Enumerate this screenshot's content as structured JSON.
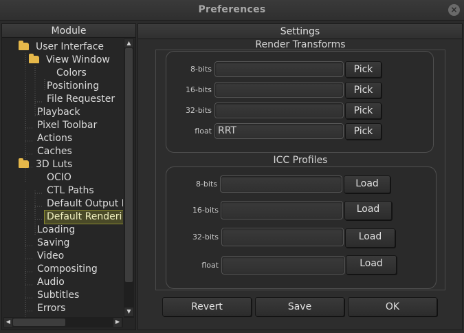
{
  "window": {
    "title": "Preferences",
    "close_glyph": "×"
  },
  "module_pane": {
    "header": "Module",
    "items": [
      {
        "label": "User Interface",
        "folder": true
      },
      {
        "label": "View Window",
        "folder": true
      },
      {
        "label": "Colors"
      },
      {
        "label": "Positioning"
      },
      {
        "label": "File Requester"
      },
      {
        "label": "Playback"
      },
      {
        "label": "Pixel Toolbar"
      },
      {
        "label": "Actions"
      },
      {
        "label": "Caches"
      },
      {
        "label": "3D Luts",
        "folder": true
      },
      {
        "label": "OCIO"
      },
      {
        "label": "CTL Paths"
      },
      {
        "label": "Default Output D"
      },
      {
        "label": "Default Renderi",
        "selected": true
      },
      {
        "label": "Loading"
      },
      {
        "label": "Saving"
      },
      {
        "label": "Video"
      },
      {
        "label": "Compositing"
      },
      {
        "label": "Audio"
      },
      {
        "label": "Subtitles"
      },
      {
        "label": "Errors"
      }
    ]
  },
  "settings_pane": {
    "header": "Settings",
    "render_transforms": {
      "title": "Render Transforms",
      "rows": [
        {
          "label": "8-bits",
          "value": "",
          "button": "Pick"
        },
        {
          "label": "16-bits",
          "value": "",
          "button": "Pick"
        },
        {
          "label": "32-bits",
          "value": "",
          "button": "Pick"
        },
        {
          "label": "float",
          "value": "RRT",
          "button": "Pick"
        }
      ]
    },
    "icc_profiles": {
      "title": "ICC Profiles",
      "rows": [
        {
          "label": "8-bits",
          "value": "",
          "button": "Load"
        },
        {
          "label": "16-bits",
          "value": "",
          "button": "Load"
        },
        {
          "label": "32-bits",
          "value": "",
          "button": "Load"
        },
        {
          "label": "float",
          "value": "",
          "button": "Load"
        }
      ]
    },
    "footer": {
      "revert": "Revert",
      "save": "Save",
      "ok": "OK"
    }
  }
}
